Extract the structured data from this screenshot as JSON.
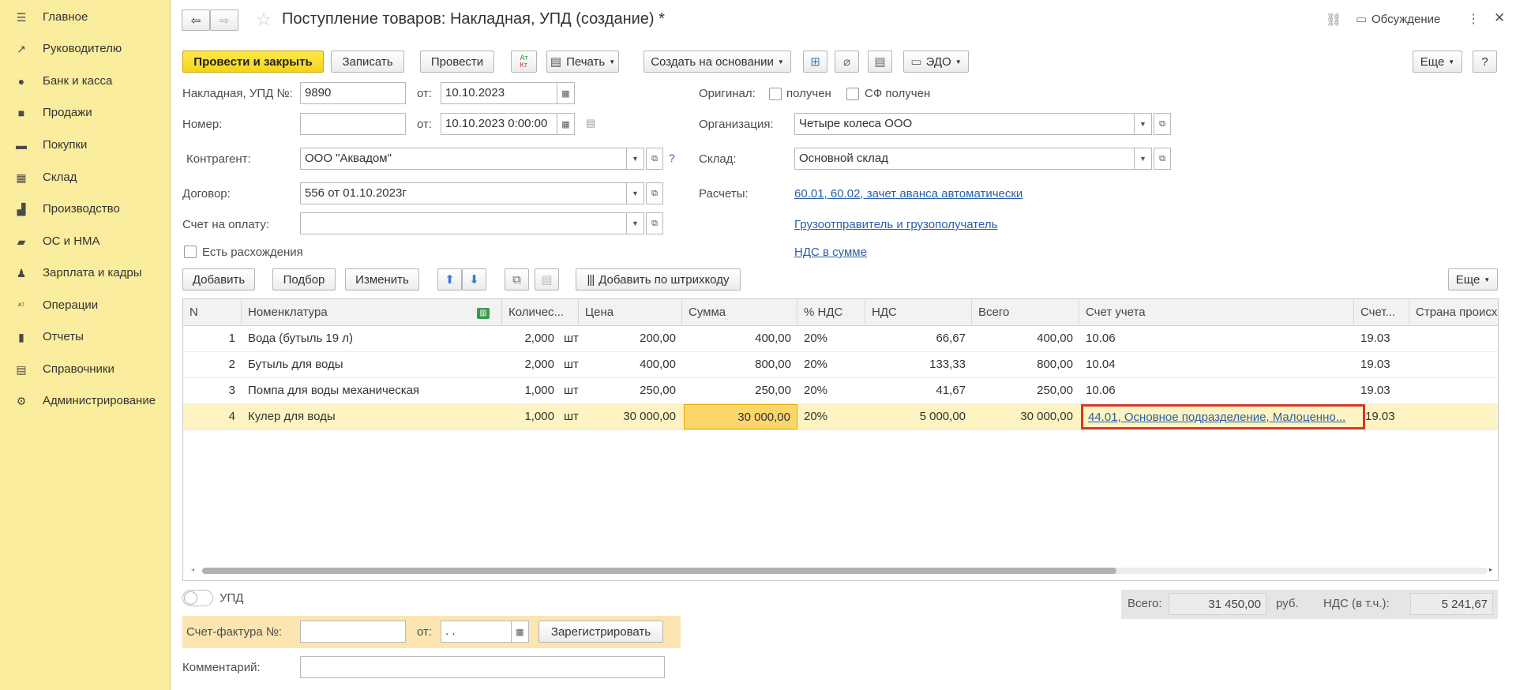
{
  "sidebar": {
    "items": [
      {
        "label": "Главное",
        "icon": "menu-icon"
      },
      {
        "label": "Руководителю",
        "icon": "trend-icon"
      },
      {
        "label": "Банк и касса",
        "icon": "coin-icon"
      },
      {
        "label": "Продажи",
        "icon": "bag-icon"
      },
      {
        "label": "Покупки",
        "icon": "cart-icon"
      },
      {
        "label": "Склад",
        "icon": "warehouse-icon"
      },
      {
        "label": "Производство",
        "icon": "factory-icon"
      },
      {
        "label": "ОС и НМА",
        "icon": "truck-icon"
      },
      {
        "label": "Зарплата и кадры",
        "icon": "person-icon"
      },
      {
        "label": "Операции",
        "icon": "dt-kt-icon"
      },
      {
        "label": "Отчеты",
        "icon": "chart-icon"
      },
      {
        "label": "Справочники",
        "icon": "books-icon"
      },
      {
        "label": "Администрирование",
        "icon": "gear-icon"
      }
    ]
  },
  "header": {
    "title": "Поступление товаров: Накладная, УПД (создание) *",
    "discussion": "Обсуждение"
  },
  "toolbar": {
    "post_close": "Провести и закрыть",
    "save": "Записать",
    "post": "Провести",
    "print": "Печать",
    "create_based": "Создать на основании",
    "edo": "ЭДО",
    "more": "Еще",
    "help": "?"
  },
  "form": {
    "invoice_no_label": "Накладная, УПД №:",
    "invoice_no": "9890",
    "from_label": "от:",
    "invoice_date": "10.10.2023",
    "number_label": "Номер:",
    "number_value": "",
    "datetime": "10.10.2023  0:00:00",
    "original_label": "Оригинал:",
    "received_label": "получен",
    "sf_received_label": "СФ получен",
    "org_label": "Организация:",
    "org": "Четыре колеса ООО",
    "counterparty_label": "Контрагент:",
    "counterparty": "ООО \"Аквадом\"",
    "help_mark": "?",
    "warehouse_label": "Склад:",
    "warehouse": "Основной склад",
    "contract_label": "Договор:",
    "contract": "556 от 01.10.2023г",
    "settlements_label": "Расчеты:",
    "settlements_link": "60.01, 60.02, зачет аванса автоматически",
    "payment_account_label": "Счет на оплату:",
    "payment_account": "",
    "shipper_link": "Грузоотправитель и грузополучатель",
    "discrepancies_label": "Есть расхождения",
    "vat_link": "НДС в сумме"
  },
  "table_toolbar": {
    "add": "Добавить",
    "pick": "Подбор",
    "change": "Изменить",
    "add_barcode": "Добавить по штрихкоду",
    "more": "Еще"
  },
  "table": {
    "headers": [
      "N",
      "Номенклатура",
      "Количес...",
      "Цена",
      "Сумма",
      "% НДС",
      "НДС",
      "Всего",
      "Счет учета",
      "Счет...",
      "Страна происхож"
    ],
    "rows": [
      {
        "n": "1",
        "name": "Вода (бутыль 19 л)",
        "qty": "2,000",
        "unit": "шт",
        "price": "200,00",
        "sum": "400,00",
        "vat_rate": "20%",
        "vat": "66,67",
        "total": "400,00",
        "account": "10.06",
        "account2": "19.03",
        "country": ""
      },
      {
        "n": "2",
        "name": "Бутыль для воды",
        "qty": "2,000",
        "unit": "шт",
        "price": "400,00",
        "sum": "800,00",
        "vat_rate": "20%",
        "vat": "133,33",
        "total": "800,00",
        "account": "10.04",
        "account2": "19.03",
        "country": ""
      },
      {
        "n": "3",
        "name": "Помпа для воды механическая",
        "qty": "1,000",
        "unit": "шт",
        "price": "250,00",
        "sum": "250,00",
        "vat_rate": "20%",
        "vat": "41,67",
        "total": "250,00",
        "account": "10.06",
        "account2": "19.03",
        "country": ""
      },
      {
        "n": "4",
        "name": "Кулер для воды",
        "qty": "1,000",
        "unit": "шт",
        "price": "30 000,00",
        "sum": "30 000,00",
        "vat_rate": "20%",
        "vat": "5 000,00",
        "total": "30 000,00",
        "account": "44.01, Основное подразделение, Малоценно...",
        "account2": "19.03",
        "country": ""
      }
    ]
  },
  "footer": {
    "upd_label": "УПД",
    "total_label": "Всего:",
    "total": "31 450,00",
    "currency": "руб.",
    "vat_incl_label": "НДС (в т.ч.):",
    "vat_total": "5 241,67",
    "sf_label": "Счет-фактура №:",
    "sf_number": "",
    "sf_from": "от:",
    "sf_date": " .  .",
    "register": "Зарегистрировать",
    "comment_label": "Комментарий:",
    "comment": ""
  },
  "colors": {
    "sidebar_bg": "#fbed9e",
    "primary_button": "#f6d31b",
    "selected_row": "#fdf3c3",
    "highlight_box": "#d23a2a",
    "link": "#2a5ea9"
  }
}
